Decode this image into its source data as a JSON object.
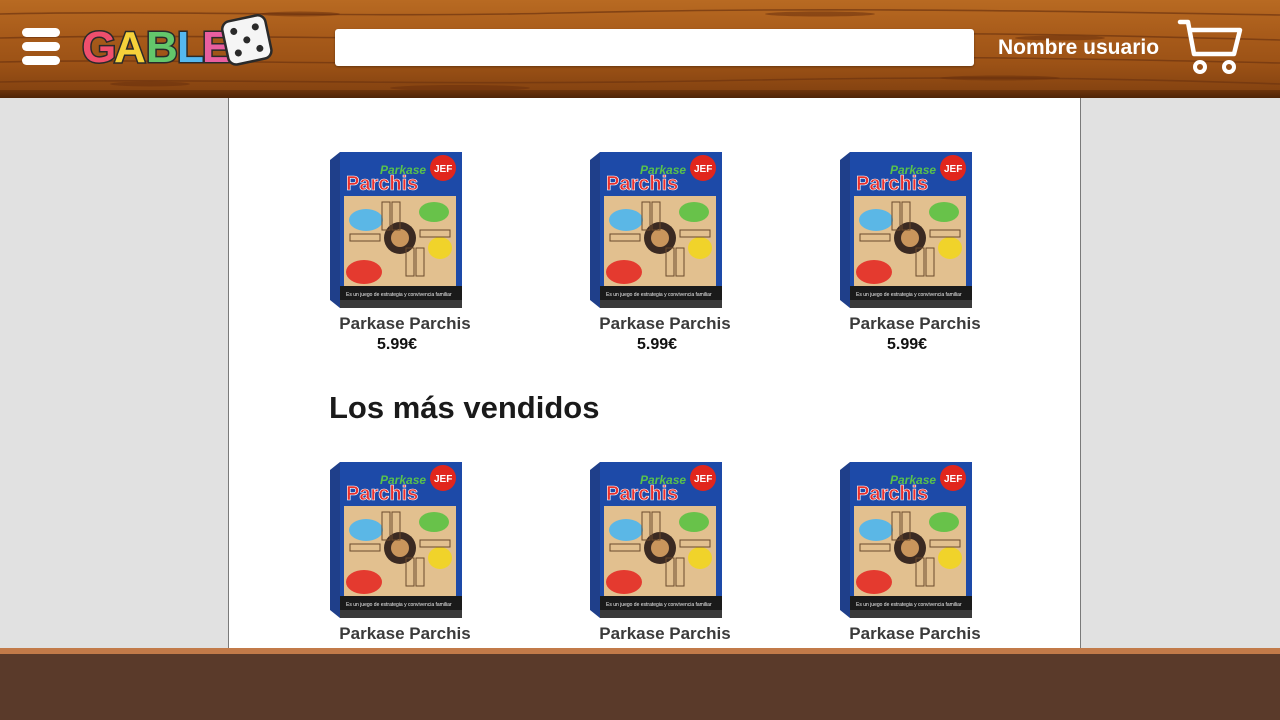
{
  "header": {
    "logo_text": "GABLE",
    "search": {
      "value": "",
      "placeholder": ""
    },
    "username": "Nombre usuario",
    "icons": {
      "menu": "hamburger-menu-icon",
      "cart": "shopping-cart-icon",
      "logo": "dice-icon"
    }
  },
  "products_top": [
    {
      "name": "Parkase Parchis",
      "price": "5.99€"
    },
    {
      "name": "Parkase Parchis",
      "price": "5.99€"
    },
    {
      "name": "Parkase Parchis",
      "price": "5.99€"
    }
  ],
  "bestsellers": {
    "title": "Los más vendidos",
    "items": [
      {
        "name": "Parkase Parchis",
        "price": ""
      },
      {
        "name": "Parkase Parchis",
        "price": ""
      },
      {
        "name": "Parkase Parchis",
        "price": ""
      }
    ]
  },
  "box_art": {
    "brand": "JEF",
    "title_small": "Parkase",
    "title_big": "Parchis",
    "tagline": "Es un juego de estrategia y convivencia familiar"
  },
  "colors": {
    "header_wood": "#a85b1a",
    "footer": "#5a3a2a",
    "footer_border": "#c27a49",
    "page_bg": "#e1e1e1",
    "panel_bg": "#ffffff"
  }
}
